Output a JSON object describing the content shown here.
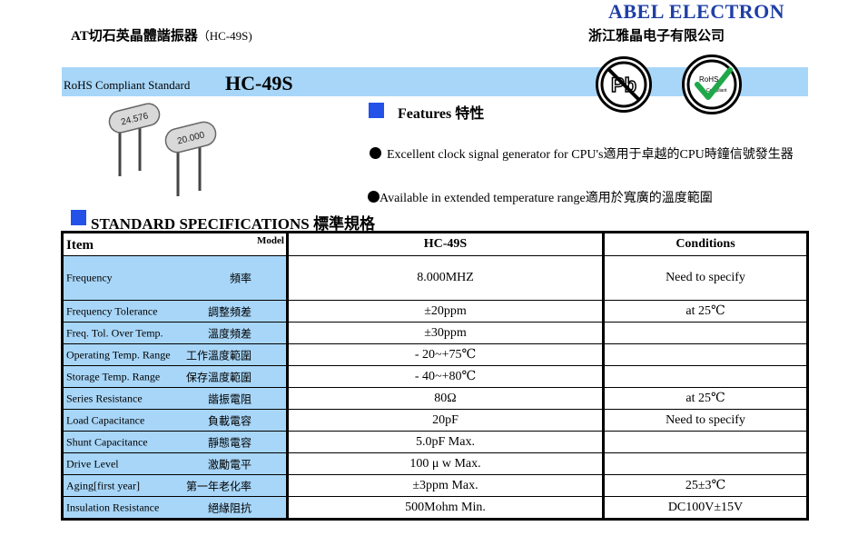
{
  "header": {
    "brand": "ABEL ELECTRON",
    "title": "AT切石英晶體諧振器",
    "title_model": "（HC-49S)",
    "company": "浙江雅晶电子有限公司"
  },
  "banner": {
    "standard": "RoHS Compliant Standard",
    "model": "HC-49S",
    "badges": [
      "pb-free-icon",
      "rohs-compliant-icon"
    ],
    "rohs_text": "RoHS",
    "compliant_text": "Compliant",
    "pb_text": "Pb"
  },
  "product_image": {
    "label1": "24.576",
    "label2": "20.000"
  },
  "features": {
    "title": "Features 特性",
    "items": [
      "Excellent clock signal generator for CPU's適用于卓越的CPU時鐘信號發生器",
      "Available in extended temperature range適用於寬廣的溫度範圍"
    ]
  },
  "specs": {
    "title": "STANDARD SPECIFICATIONS 標準規格",
    "header": {
      "item": "Item",
      "model": "Model",
      "value": "HC-49S",
      "conditions": "Conditions"
    },
    "rows": [
      {
        "en": "Frequency",
        "zh": "頻率",
        "value": "8.000MHZ",
        "cond": "Need to specify"
      },
      {
        "en": "Frequency Tolerance",
        "zh": "調整頻差",
        "value": "±20ppm",
        "cond": "at 25℃"
      },
      {
        "en": "Freq. Tol. Over Temp.",
        "zh": "溫度頻差",
        "value": "±30ppm",
        "cond": ""
      },
      {
        "en": "Operating Temp. Range",
        "zh": "工作溫度範圍",
        "value": "- 20~+75℃",
        "cond": ""
      },
      {
        "en": "Storage Temp.  Range",
        "zh": "保存溫度範圍",
        "value": "- 40~+80℃",
        "cond": ""
      },
      {
        "en": "Series Resistance",
        "zh": "諧振電阻",
        "value": "80Ω",
        "cond": "at 25℃"
      },
      {
        "en": "Load Capacitance",
        "zh": "負載電容",
        "value": "20pF",
        "cond": "Need to specify"
      },
      {
        "en": "Shunt Capacitance",
        "zh": "靜態電容",
        "value": "5.0pF Max.",
        "cond": ""
      },
      {
        "en": "Drive Level",
        "zh": "激勵電平",
        "value": "100 μ w  Max.",
        "cond": ""
      },
      {
        "en": "Aging[first year]",
        "zh": "第一年老化率",
        "value": "±3ppm Max.",
        "cond": "25±3℃"
      },
      {
        "en": "Insulation Resistance",
        "zh": "絕緣阻抗",
        "value": "500Mohm Min.",
        "cond": "DC100V±15V"
      }
    ]
  }
}
